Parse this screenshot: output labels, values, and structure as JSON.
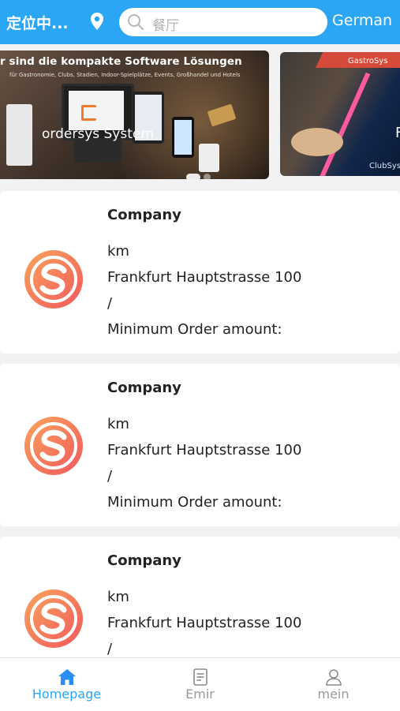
{
  "header": {
    "location": "定位中...",
    "search_placeholder": "餐厅",
    "language": "German"
  },
  "colors": {
    "primary": "#2aa6f5",
    "logo_gradient_start": "#f9a45c",
    "logo_gradient_end": "#f2585e"
  },
  "banners": [
    {
      "headline": "r sind die kompakte Software Lösungen",
      "subline": "für Gastronomie, Clubs, Stadien, Indoor-Spielplätze, Events, Großhandel und Hotels",
      "brand": "ordersys System"
    },
    {
      "top_label": "GastroSys",
      "bottom_label": "ClubSys",
      "partial_text": "F"
    }
  ],
  "companies": [
    {
      "name": "Company",
      "distance": "km",
      "address": "Frankfurt Hauptstrasse 100",
      "separator": "/",
      "min_order": "Minimum Order amount:"
    },
    {
      "name": "Company",
      "distance": "km",
      "address": "Frankfurt Hauptstrasse 100",
      "separator": "/",
      "min_order": "Minimum Order amount:"
    },
    {
      "name": "Company",
      "distance": "km",
      "address": "Frankfurt Hauptstrasse 100",
      "separator": "/"
    }
  ],
  "tabbar": {
    "items": [
      {
        "label": "Homepage",
        "icon": "home-icon",
        "active": true
      },
      {
        "label": "Emir",
        "icon": "document-icon",
        "active": false
      },
      {
        "label": "mein",
        "icon": "user-icon",
        "active": false
      }
    ]
  }
}
